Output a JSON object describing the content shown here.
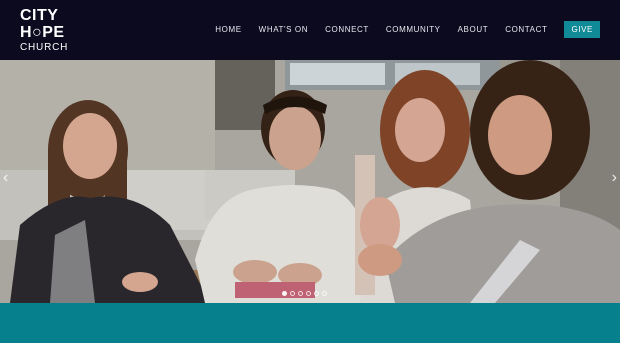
{
  "logo": {
    "line1": "CITY",
    "line2": "H○PE",
    "line3": "CHURCH"
  },
  "nav": {
    "items": [
      "HOME",
      "WHAT'S ON",
      "CONNECT",
      "COMMUNITY",
      "ABOUT",
      "CONTACT"
    ],
    "give_label": "GIVE"
  },
  "slider": {
    "prev_icon": "chevron-left-icon",
    "next_icon": "chevron-right-icon",
    "slide_count": 6,
    "active_index": 0
  },
  "colors": {
    "header_bg": "#0b0a1f",
    "give_bg": "#0f8a96",
    "band_bg": "#07808e"
  }
}
